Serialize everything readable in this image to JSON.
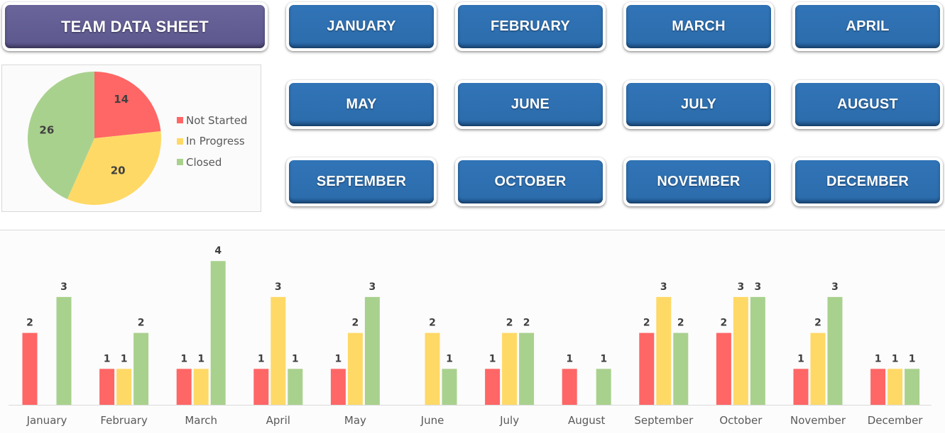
{
  "header": {
    "title": "TEAM DATA SHEET"
  },
  "month_buttons": [
    "JANUARY",
    "FEBRUARY",
    "MARCH",
    "APRIL",
    "MAY",
    "JUNE",
    "JULY",
    "AUGUST",
    "SEPTEMBER",
    "OCTOBER",
    "NOVEMBER",
    "DECEMBER"
  ],
  "colors": {
    "not_started": "#ff6666",
    "in_progress": "#ffd966",
    "closed": "#a9d18e",
    "title_button": "#5f5a8f",
    "month_button": "#2e6fb0"
  },
  "chart_data": [
    {
      "type": "pie",
      "title": "",
      "labels": [
        "Not Started",
        "In Progress",
        "Closed"
      ],
      "values": [
        14,
        20,
        26
      ],
      "legend": "right",
      "data_labels": [
        "14",
        "20",
        "26"
      ]
    },
    {
      "type": "bar",
      "title": "",
      "xlabel": "",
      "ylabel": "",
      "categories": [
        "January",
        "February",
        "March",
        "April",
        "May",
        "June",
        "July",
        "August",
        "September",
        "October",
        "November",
        "December"
      ],
      "series": [
        {
          "name": "Not Started",
          "values": [
            2,
            1,
            1,
            1,
            1,
            0,
            1,
            1,
            2,
            2,
            1,
            1
          ]
        },
        {
          "name": "In Progress",
          "values": [
            0,
            1,
            1,
            3,
            2,
            2,
            2,
            0,
            3,
            3,
            2,
            1
          ]
        },
        {
          "name": "Closed",
          "values": [
            3,
            2,
            4,
            1,
            3,
            1,
            2,
            1,
            2,
            3,
            3,
            1
          ]
        }
      ],
      "ylim": [
        0,
        4.4
      ],
      "grid": false,
      "legend": "none",
      "data_labels": true
    }
  ]
}
